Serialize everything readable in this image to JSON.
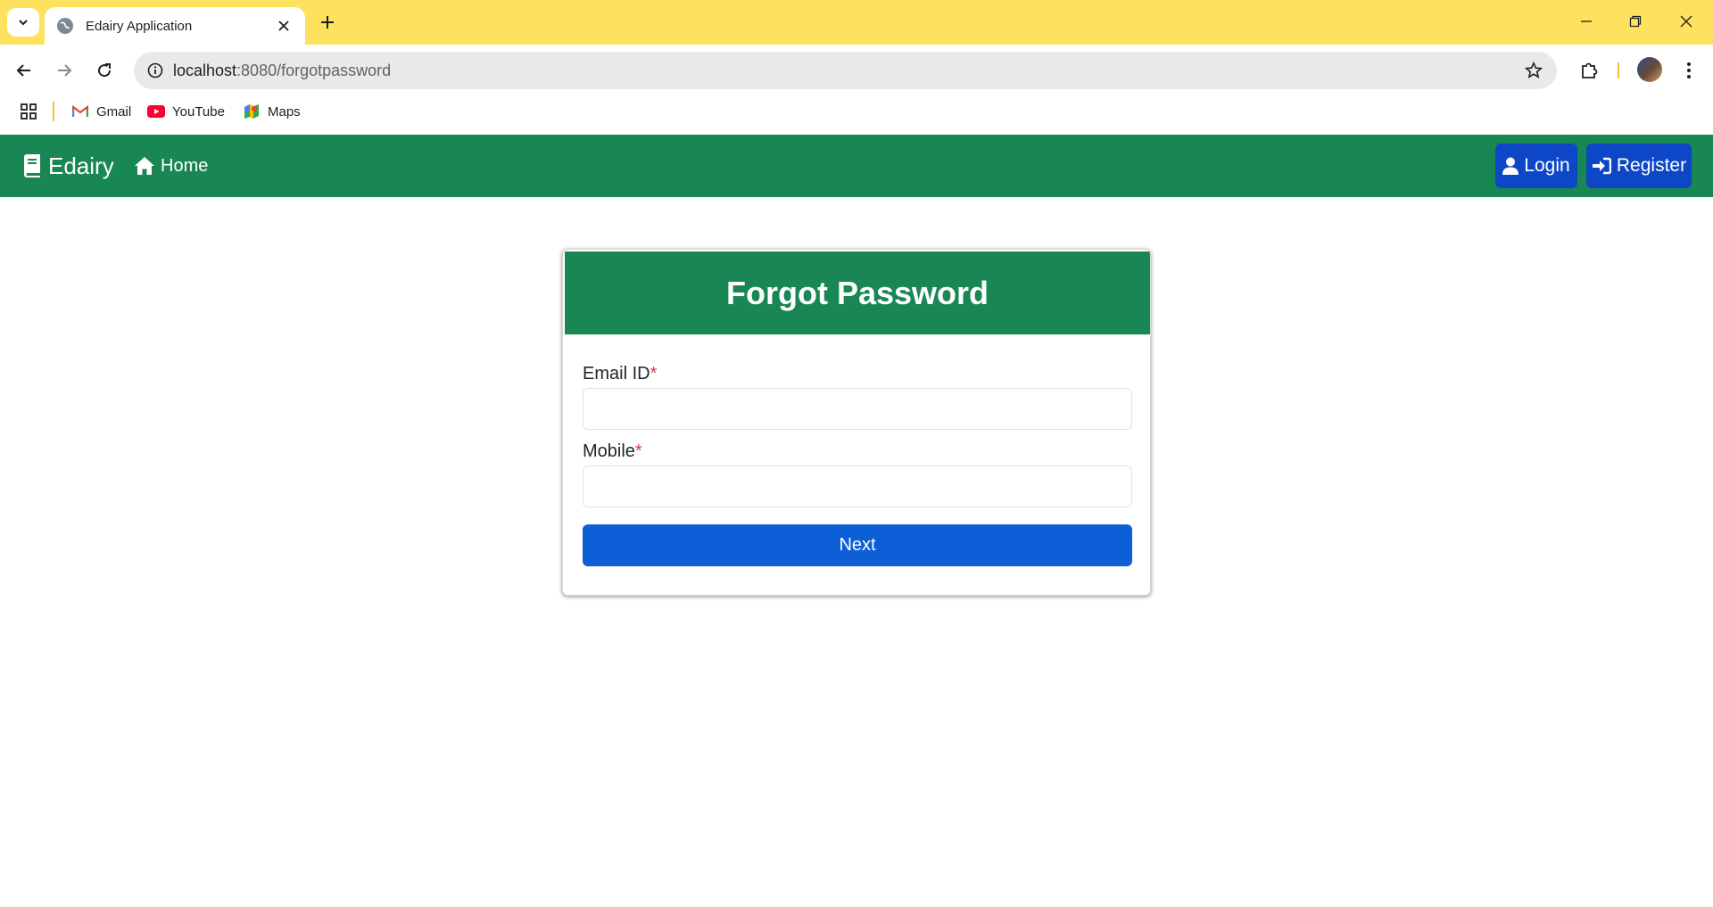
{
  "browser": {
    "tab_title": "Edairy Application",
    "url_host": "localhost",
    "url_path": ":8080/forgotpassword",
    "bookmarks": [
      {
        "label": "Gmail",
        "icon": "gmail-icon"
      },
      {
        "label": "YouTube",
        "icon": "youtube-icon"
      },
      {
        "label": "Maps",
        "icon": "maps-icon"
      }
    ]
  },
  "navbar": {
    "brand": "Edairy",
    "home": "Home",
    "login": "Login",
    "register": "Register",
    "color": "#198754"
  },
  "form": {
    "title": "Forgot Password",
    "email_label": "Email ID",
    "mobile_label": "Mobile",
    "required_marker": "*",
    "email_value": "",
    "mobile_value": "",
    "submit": "Next"
  },
  "colors": {
    "primary": "#0d5fd8",
    "success": "#198754",
    "danger": "#dc3545",
    "tabbar": "#fee15e"
  }
}
